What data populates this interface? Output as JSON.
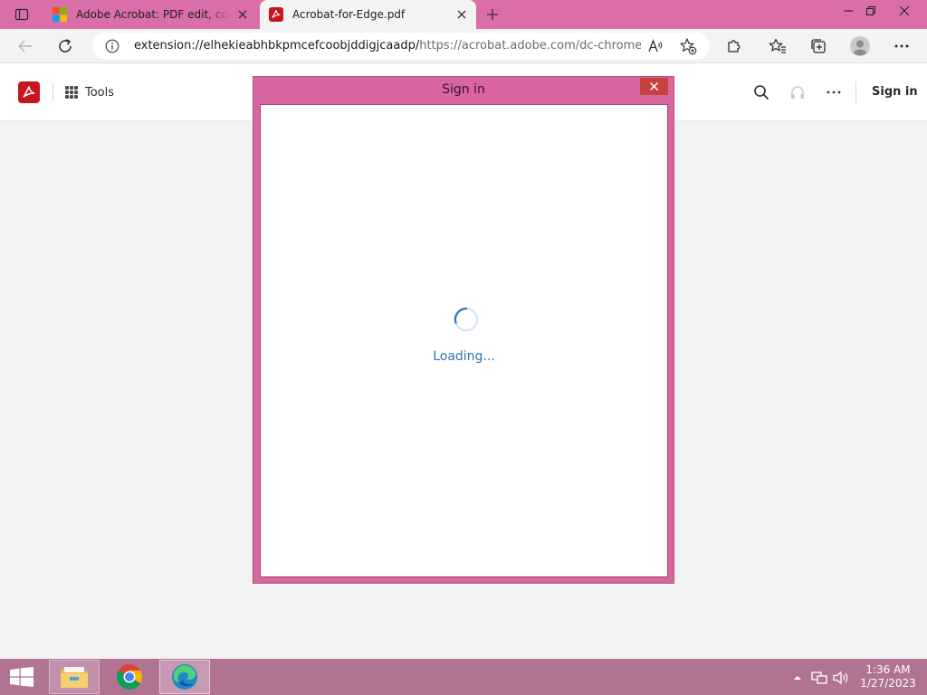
{
  "browser": {
    "tabs": [
      {
        "title": "Adobe Acrobat: PDF edit, convert, sign tools",
        "favicon": "microsoft-logo-icon",
        "active": false
      },
      {
        "title": "Acrobat-for-Edge.pdf",
        "favicon": "acrobat-icon",
        "active": true
      }
    ],
    "address": {
      "host": "extension://elhekieabhbkpmcefcoobjddigjcaadp/",
      "rest": "https://acrobat.adobe.com/dc-chrome-..."
    },
    "toolbar_icons": [
      "back-icon",
      "refresh-icon",
      "read-aloud-icon",
      "add-favorite-icon",
      "extensions-icon",
      "favorites-icon",
      "collections-icon",
      "profile-icon",
      "more-icon"
    ]
  },
  "acrobat": {
    "tools_label": "Tools",
    "signin_label": "Sign in",
    "icons": [
      "search-icon",
      "headphones-icon",
      "more-icon"
    ]
  },
  "popup": {
    "title": "Sign in",
    "loading_text": "Loading..."
  },
  "taskbar": {
    "apps": [
      "file-explorer-icon",
      "chrome-icon",
      "edge-icon"
    ],
    "time": "1:36 AM",
    "date": "1/27/2023"
  },
  "colors": {
    "titlebar": "#da6ea6",
    "popup_frame": "#d9669f",
    "popup_close": "#c7413f",
    "acrobat_red": "#c4161c",
    "loading_text": "#2e75b6",
    "taskbar": "#b07394"
  }
}
